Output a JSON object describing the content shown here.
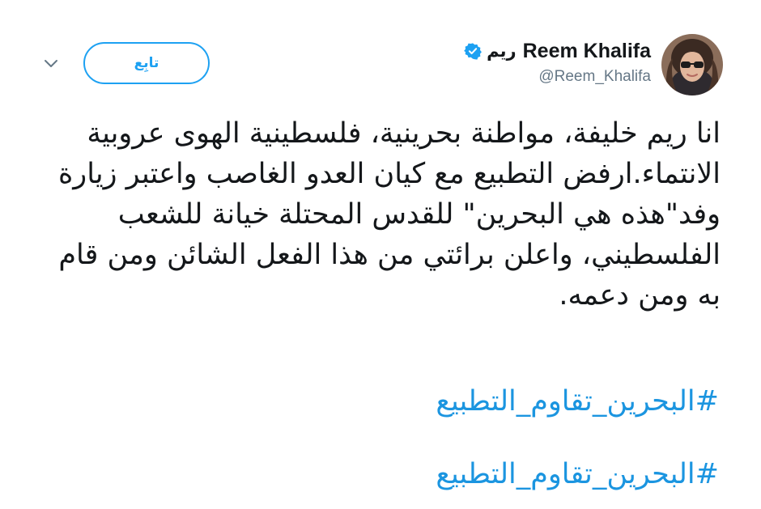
{
  "author": {
    "display_name_en": "Reem Khalifa",
    "display_name_ar": "ريم",
    "handle": "@Reem_Khalifa",
    "verified_icon": "verified-badge-icon",
    "avatar_icon": "profile-avatar"
  },
  "actions": {
    "follow_label": "تابِع",
    "menu_icon": "chevron-down-icon"
  },
  "tweet": {
    "text": "انا ريم خليفة، مواطنة بحرينية، فلسطينية الهوى عروبية الانتماء.ارفض التطبيع مع كيان العدو الغاصب واعتبر زيارة وفد\"هذه هي البحرين\" للقدس المحتلة خيانة للشعب الفلسطيني، واعلن برائتي من هذا الفعل الشائن ومن قام به ومن دعمه.",
    "hashtags": [
      "#البحرين_تقاوم_التطبيع",
      "#البحرين_تقاوم_التطبيع"
    ]
  },
  "colors": {
    "accent": "#1da1f2",
    "link": "#1b95e0",
    "text": "#14171a",
    "muted": "#657786"
  }
}
